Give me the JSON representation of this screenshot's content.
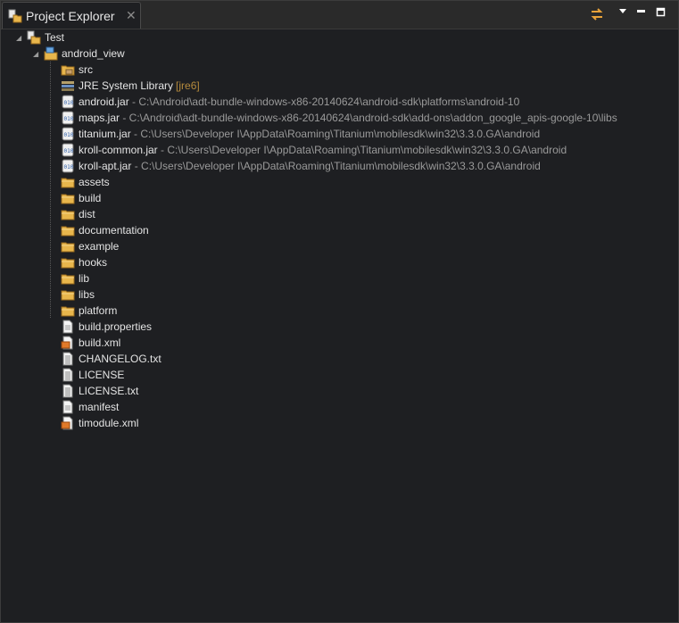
{
  "view": {
    "title": "Project Explorer",
    "close_glyph": "✕",
    "toolbar": [
      {
        "name": "link-with-editor-icon"
      },
      {
        "name": "view-menu-icon"
      },
      {
        "name": "minimize-icon"
      },
      {
        "name": "maximize-icon"
      }
    ]
  },
  "tree": {
    "project": {
      "label": "Test",
      "icon": "project-folder-icon"
    },
    "subproject": {
      "label": "android_view",
      "icon": "android-project-icon"
    },
    "items": [
      {
        "label": "src",
        "decoration": "",
        "icon": "source-folder-icon"
      },
      {
        "label": "JRE System Library",
        "decoration": "[jre6]",
        "icon": "library-icon"
      },
      {
        "label": "android.jar",
        "decoration": " - C:\\Android\\adt-bundle-windows-x86-20140624\\android-sdk\\platforms\\android-10",
        "icon": "jar-icon"
      },
      {
        "label": "maps.jar",
        "decoration": " - C:\\Android\\adt-bundle-windows-x86-20140624\\android-sdk\\add-ons\\addon_google_apis-google-10\\libs",
        "icon": "jar-icon"
      },
      {
        "label": "titanium.jar",
        "decoration": " - C:\\Users\\Developer I\\AppData\\Roaming\\Titanium\\mobilesdk\\win32\\3.3.0.GA\\android",
        "icon": "jar-icon"
      },
      {
        "label": "kroll-common.jar",
        "decoration": " - C:\\Users\\Developer I\\AppData\\Roaming\\Titanium\\mobilesdk\\win32\\3.3.0.GA\\android",
        "icon": "jar-icon"
      },
      {
        "label": "kroll-apt.jar",
        "decoration": " - C:\\Users\\Developer I\\AppData\\Roaming\\Titanium\\mobilesdk\\win32\\3.3.0.GA\\android",
        "icon": "jar-icon"
      },
      {
        "label": "assets",
        "decoration": "",
        "icon": "folder-icon"
      },
      {
        "label": "build",
        "decoration": "",
        "icon": "folder-icon"
      },
      {
        "label": "dist",
        "decoration": "",
        "icon": "folder-icon"
      },
      {
        "label": "documentation",
        "decoration": "",
        "icon": "folder-icon"
      },
      {
        "label": "example",
        "decoration": "",
        "icon": "folder-icon"
      },
      {
        "label": "hooks",
        "decoration": "",
        "icon": "folder-icon"
      },
      {
        "label": "lib",
        "decoration": "",
        "icon": "folder-icon"
      },
      {
        "label": "libs",
        "decoration": "",
        "icon": "folder-icon"
      },
      {
        "label": "platform",
        "decoration": "",
        "icon": "folder-icon"
      },
      {
        "label": "build.properties",
        "decoration": "",
        "icon": "file-icon"
      },
      {
        "label": "build.xml",
        "decoration": "",
        "icon": "xml-file-icon"
      },
      {
        "label": "CHANGELOG.txt",
        "decoration": "",
        "icon": "text-file-icon"
      },
      {
        "label": "LICENSE",
        "decoration": "",
        "icon": "text-file-icon"
      },
      {
        "label": "LICENSE.txt",
        "decoration": "",
        "icon": "text-file-icon"
      },
      {
        "label": "manifest",
        "decoration": "",
        "icon": "file-icon"
      },
      {
        "label": "timodule.xml",
        "decoration": "",
        "icon": "xml-file-icon"
      }
    ]
  }
}
